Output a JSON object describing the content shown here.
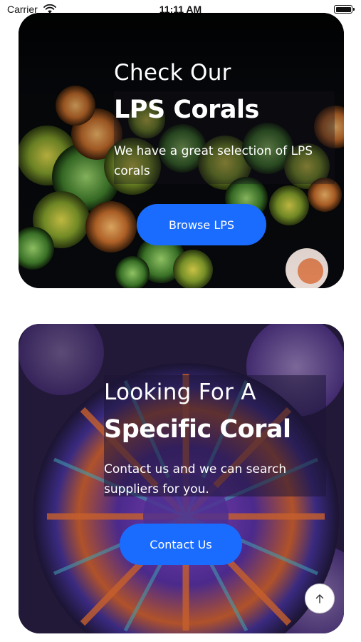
{
  "status_bar": {
    "carrier": "Carrier",
    "time": "11:11 AM"
  },
  "cards": [
    {
      "eyebrow": "Check Our",
      "headline": "LPS Corals",
      "description": "We have a great selection of LPS corals",
      "button_label": "Browse LPS"
    },
    {
      "eyebrow": "Looking For A",
      "headline": "Specific Coral",
      "description": "Contact us and we can search suppliers for you.",
      "button_label": "Contact Us"
    }
  ],
  "colors": {
    "accent": "#1a6cff",
    "card1_bg": "#05070a",
    "card2_bg": "#1b1430"
  },
  "icons": {
    "scroll_top": "arrow-up-icon"
  }
}
